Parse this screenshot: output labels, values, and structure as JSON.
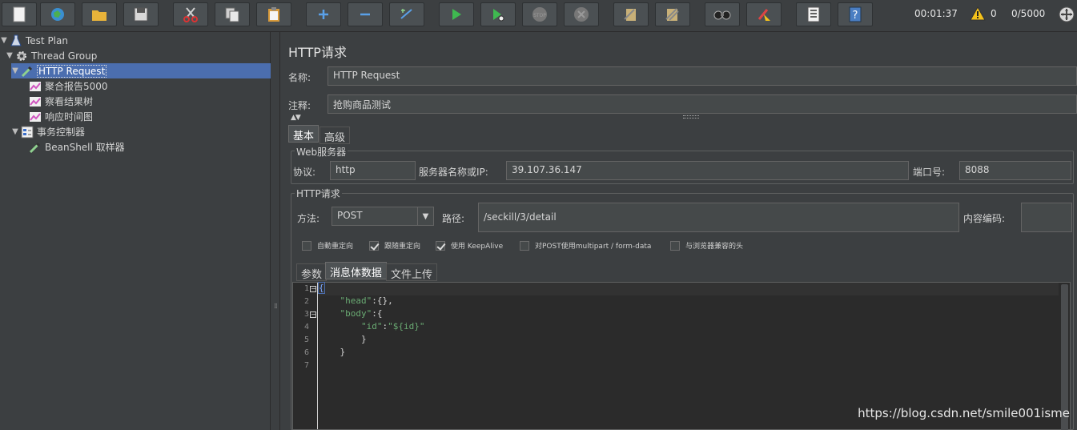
{
  "toolbar": {
    "timer": "00:01:37",
    "warning_count": "0",
    "thread_count": "0/5000"
  },
  "tree": {
    "items": [
      {
        "label": "Test Plan"
      },
      {
        "label": "Thread Group"
      },
      {
        "label": "HTTP Request"
      },
      {
        "label": "聚合报告5000"
      },
      {
        "label": "察看结果树"
      },
      {
        "label": "响应时间图"
      },
      {
        "label": "事务控制器"
      },
      {
        "label": "BeanShell 取样器"
      }
    ]
  },
  "sampler": {
    "title": "HTTP请求",
    "name_label": "名称:",
    "name_value": "HTTP Request",
    "comment_label": "注释:",
    "comment_value": "抢购商品测试",
    "tabs": [
      "基本",
      "高级"
    ],
    "web_server": {
      "group_title": "Web服务器",
      "protocol_label": "协议:",
      "protocol_value": "http",
      "server_label": "服务器名称或IP:",
      "server_value": "39.107.36.147",
      "port_label": "端口号:",
      "port_value": "8088"
    },
    "http_request": {
      "group_title": "HTTP请求",
      "method_label": "方法:",
      "method_value": "POST",
      "path_label": "路径:",
      "path_value": "/seckill/3/detail",
      "encoding_label": "内容编码:",
      "encoding_value": ""
    },
    "options": [
      {
        "label": "自動重定向",
        "checked": false
      },
      {
        "label": "跟随重定向",
        "checked": true
      },
      {
        "label": "使用 KeepAlive",
        "checked": true
      },
      {
        "label": "对POST使用multipart / form-data",
        "checked": false
      },
      {
        "label": "与浏览器兼容的头",
        "checked": false
      }
    ],
    "body_tabs": [
      "参数",
      "消息体数据",
      "文件上传"
    ],
    "body_lines": [
      {
        "num": "1",
        "text": "{"
      },
      {
        "num": "2",
        "text": "    \"head\":{},"
      },
      {
        "num": "3",
        "text": "    \"body\":{"
      },
      {
        "num": "4",
        "text": "        \"id\":\"${id}\""
      },
      {
        "num": "5",
        "text": "        }"
      },
      {
        "num": "6",
        "text": "    }"
      },
      {
        "num": "7",
        "text": ""
      }
    ]
  },
  "watermark": "https://blog.csdn.net/smile001isme"
}
